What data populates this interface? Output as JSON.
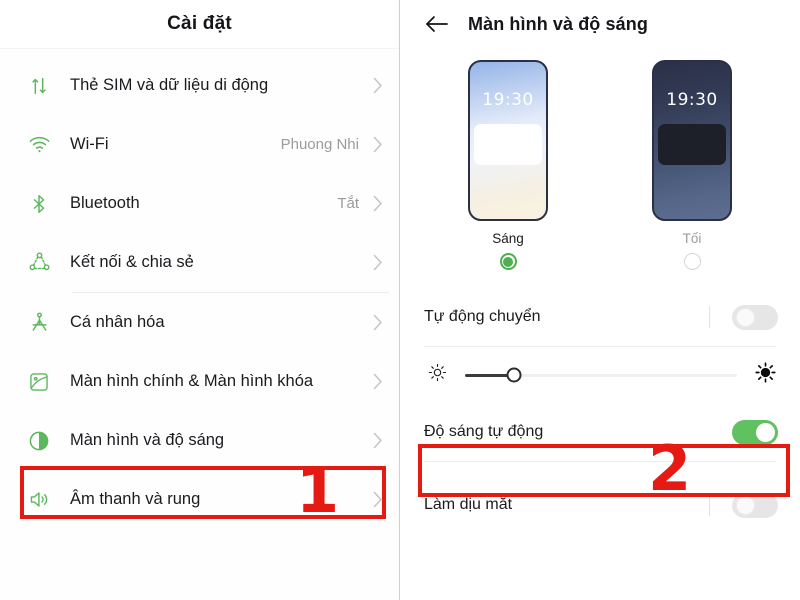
{
  "left_panel": {
    "header_title": "Cài đặt",
    "items": [
      {
        "icon": "mobile-data-icon",
        "label": "Thẻ SIM và dữ liệu di động",
        "value": "",
        "chevron": "›"
      },
      {
        "icon": "wifi-icon",
        "label": "Wi-Fi",
        "value": "Phuong Nhi",
        "chevron": "›"
      },
      {
        "icon": "bluetooth-icon",
        "label": "Bluetooth",
        "value": "Tắt",
        "chevron": "›"
      },
      {
        "icon": "connection-share-icon",
        "label": "Kết nối & chia sẻ",
        "value": "",
        "chevron": "›"
      },
      {
        "icon": "personalization-icon",
        "label": "Cá nhân hóa",
        "value": "",
        "chevron": "›"
      },
      {
        "icon": "home-lock-screen-icon",
        "label": "Màn hình chính & Màn hình khóa",
        "value": "",
        "chevron": "›"
      },
      {
        "icon": "display-brightness-icon",
        "label": "Màn hình và độ sáng",
        "value": "",
        "chevron": "›"
      },
      {
        "icon": "sound-vibration-icon",
        "label": "Âm thanh và rung",
        "value": "",
        "chevron": "›"
      }
    ]
  },
  "right_panel": {
    "back_icon": "back-arrow-icon",
    "header_title": "Màn hình và độ sáng",
    "themes": [
      {
        "name": "light",
        "clock": "19:30",
        "label": "Sáng",
        "selected": true
      },
      {
        "name": "dark",
        "clock": "19:30",
        "label": "Tối",
        "selected": false
      }
    ],
    "auto_switch_row": {
      "label": "Tự động chuyển",
      "toggle_state": "off"
    },
    "brightness_slider": {
      "low_icon": "brightness-low-icon",
      "high_icon": "brightness-high-icon",
      "value_percent": 18
    },
    "auto_brightness_row": {
      "label": "Độ sáng tự động",
      "toggle_state": "on"
    },
    "eye_comfort_row": {
      "label": "Làm dịu mắt",
      "toggle_state": "off"
    }
  },
  "annotations": [
    {
      "number": "1",
      "target": "Màn hình và độ sáng"
    },
    {
      "number": "2",
      "target": "Độ sáng tự động"
    }
  ],
  "colors": {
    "accent_green": "#5cb85c",
    "toggle_on_green": "#5fc15f",
    "annotation_red": "#e51a13",
    "text_primary": "#1b1b1f",
    "text_secondary": "#9b9b9b"
  }
}
